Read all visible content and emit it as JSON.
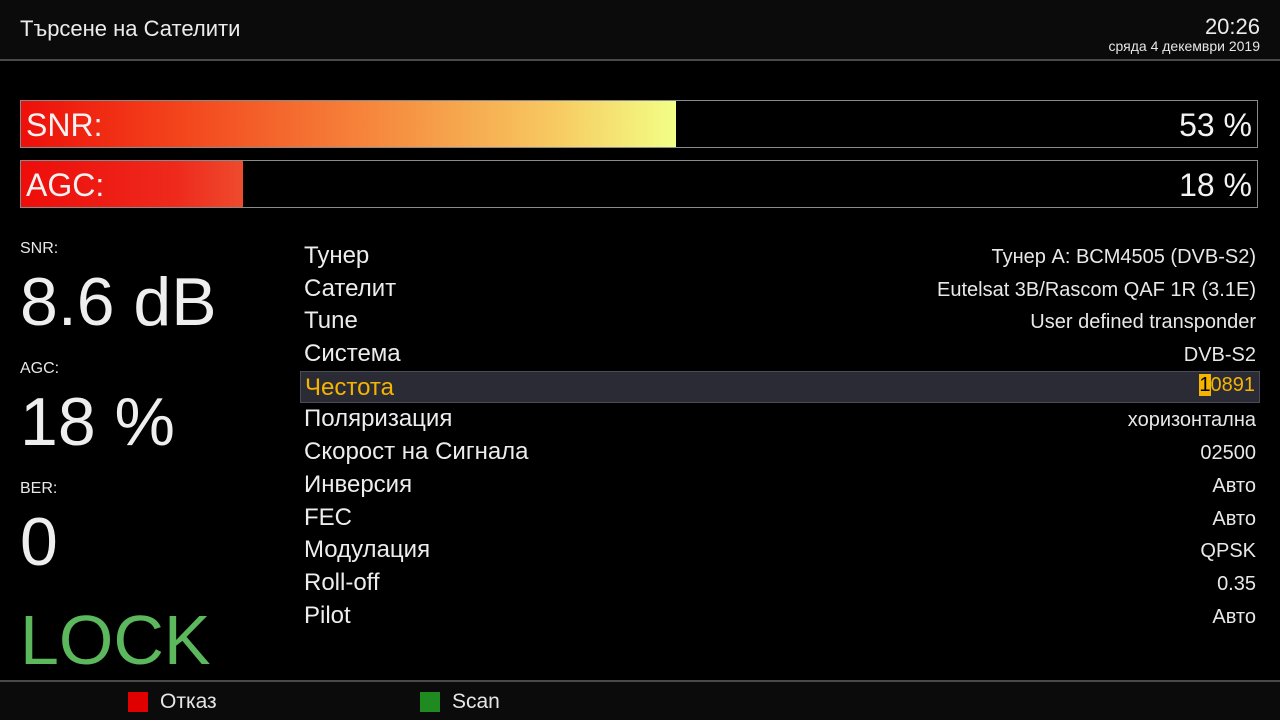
{
  "header": {
    "title": "Търсене на Сателити",
    "time": "20:26",
    "date": "сряда  4 декември 2019"
  },
  "bars": {
    "snr": {
      "label": "SNR:",
      "value_text": "53 %",
      "fill_percent": 53
    },
    "agc": {
      "label": "AGC:",
      "value_text": "18 %",
      "fill_percent": 18
    }
  },
  "stats": {
    "snr_label": "SNR:",
    "snr_value": "8.6 dB",
    "agc_label": "AGC:",
    "agc_value": "18 %",
    "ber_label": "BER:",
    "ber_value": "0",
    "lock_status": "LOCK"
  },
  "params": [
    {
      "name": "Тунер",
      "value": "Тунер A: BCM4505 (DVB-S2)"
    },
    {
      "name": "Сателит",
      "value": "Eutelsat 3B/Rascom QAF 1R (3.1E)"
    },
    {
      "name": "Tune",
      "value": "User defined transponder"
    },
    {
      "name": "Система",
      "value": "DVB-S2"
    },
    {
      "name": "Честота",
      "value_cursor": "1",
      "value_rest": "0891",
      "selected": true
    },
    {
      "name": "Поляризация",
      "value": "хоризонтална"
    },
    {
      "name": "Скорост на Сигнала",
      "value": "02500"
    },
    {
      "name": "Инверсия",
      "value": "Авто"
    },
    {
      "name": "FEC",
      "value": "Авто"
    },
    {
      "name": "Модулация",
      "value": "QPSK"
    },
    {
      "name": "Roll-off",
      "value": "0.35"
    },
    {
      "name": "Pilot",
      "value": "Авто"
    }
  ],
  "footer": {
    "red_label": "Отказ",
    "green_label": "Scan"
  },
  "colors": {
    "lock": "#5cb85c",
    "selected_text": "#f5b400",
    "red_key": "#e00000",
    "green_key": "#1f8a1f"
  }
}
